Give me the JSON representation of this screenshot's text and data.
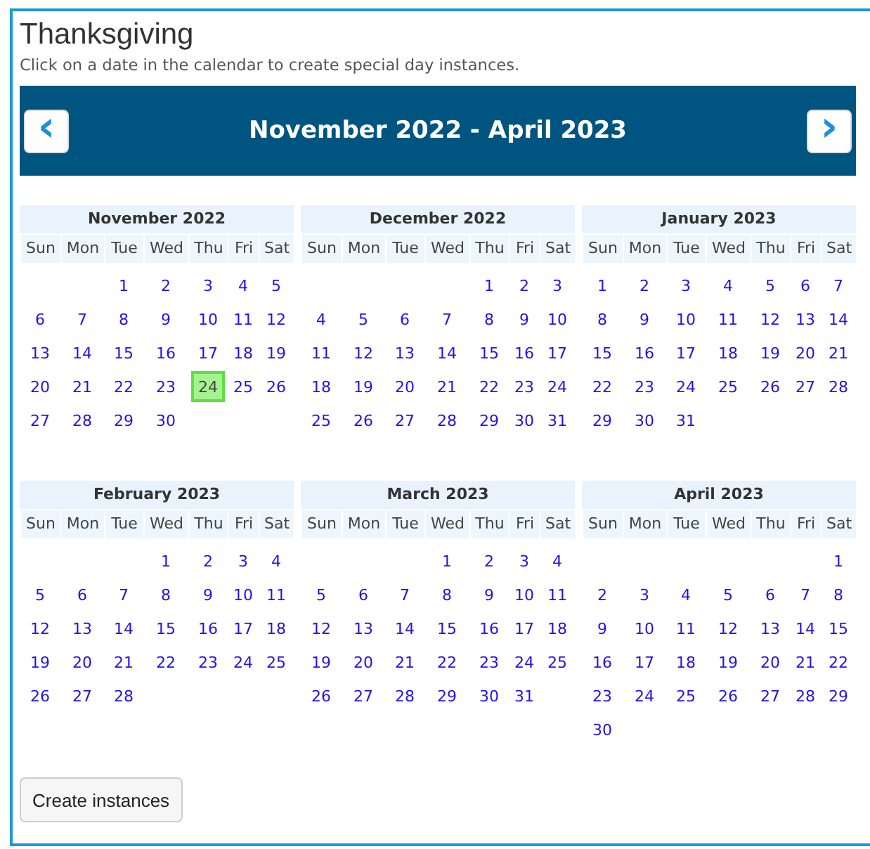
{
  "title": "Thanksgiving",
  "instructions": "Click on a date in the calendar to create special day instances.",
  "navigator": {
    "prev_button": "‹",
    "range": "November 2022 - April 2023",
    "next_button": "›"
  },
  "months": [
    {
      "name": "November 2022",
      "weekdays": [
        "Sun",
        "Mon",
        "Tue",
        "Wed",
        "Thu",
        "Fri",
        "Sat"
      ],
      "weeks": [
        [
          {
            "day": "1",
            "selected": false
          },
          {
            "day": "2",
            "selected": false
          },
          {
            "day": "3",
            "selected": false
          },
          {
            "day": "4",
            "selected": false
          },
          {
            "day": "5",
            "selected": false
          }
        ],
        [
          {
            "day": "6",
            "selected": false
          },
          {
            "day": "7",
            "selected": false
          },
          {
            "day": "8",
            "selected": false
          },
          {
            "day": "9",
            "selected": false
          },
          {
            "day": "10",
            "selected": false
          },
          {
            "day": "11",
            "selected": false
          },
          {
            "day": "12",
            "selected": false
          }
        ],
        [
          {
            "day": "13",
            "selected": false
          },
          {
            "day": "14",
            "selected": false
          },
          {
            "day": "15",
            "selected": false
          },
          {
            "day": "16",
            "selected": false
          },
          {
            "day": "17",
            "selected": false
          },
          {
            "day": "18",
            "selected": false
          },
          {
            "day": "19",
            "selected": false
          }
        ],
        [
          {
            "day": "20",
            "selected": false
          },
          {
            "day": "21",
            "selected": false
          },
          {
            "day": "22",
            "selected": false
          },
          {
            "day": "23",
            "selected": false
          },
          {
            "day": "24",
            "selected": true
          },
          {
            "day": "25",
            "selected": false
          },
          {
            "day": "26",
            "selected": false
          }
        ],
        [
          {
            "day": "27",
            "selected": false
          },
          {
            "day": "28",
            "selected": false
          },
          {
            "day": "29",
            "selected": false
          },
          {
            "day": "30",
            "selected": false
          }
        ]
      ]
    },
    {
      "name": "December 2022",
      "weekdays": [
        "Sun",
        "Mon",
        "Tue",
        "Wed",
        "Thu",
        "Fri",
        "Sat"
      ],
      "weeks": [
        [
          {
            "day": "1",
            "selected": false
          },
          {
            "day": "2",
            "selected": false
          },
          {
            "day": "3",
            "selected": false
          }
        ],
        [
          {
            "day": "4",
            "selected": false
          },
          {
            "day": "5",
            "selected": false
          },
          {
            "day": "6",
            "selected": false
          },
          {
            "day": "7",
            "selected": false
          },
          {
            "day": "8",
            "selected": false
          },
          {
            "day": "9",
            "selected": false
          },
          {
            "day": "10",
            "selected": false
          }
        ],
        [
          {
            "day": "11",
            "selected": false
          },
          {
            "day": "12",
            "selected": false
          },
          {
            "day": "13",
            "selected": false
          },
          {
            "day": "14",
            "selected": false
          },
          {
            "day": "15",
            "selected": false
          },
          {
            "day": "16",
            "selected": false
          },
          {
            "day": "17",
            "selected": false
          }
        ],
        [
          {
            "day": "18",
            "selected": false
          },
          {
            "day": "19",
            "selected": false
          },
          {
            "day": "20",
            "selected": false
          },
          {
            "day": "21",
            "selected": false
          },
          {
            "day": "22",
            "selected": false
          },
          {
            "day": "23",
            "selected": false
          },
          {
            "day": "24",
            "selected": false
          }
        ],
        [
          {
            "day": "25",
            "selected": false
          },
          {
            "day": "26",
            "selected": false
          },
          {
            "day": "27",
            "selected": false
          },
          {
            "day": "28",
            "selected": false
          },
          {
            "day": "29",
            "selected": false
          },
          {
            "day": "30",
            "selected": false
          },
          {
            "day": "31",
            "selected": false
          }
        ]
      ]
    },
    {
      "name": "January 2023",
      "weekdays": [
        "Sun",
        "Mon",
        "Tue",
        "Wed",
        "Thu",
        "Fri",
        "Sat"
      ],
      "weeks": [
        [
          {
            "day": "1",
            "selected": false
          },
          {
            "day": "2",
            "selected": false
          },
          {
            "day": "3",
            "selected": false
          },
          {
            "day": "4",
            "selected": false
          },
          {
            "day": "5",
            "selected": false
          },
          {
            "day": "6",
            "selected": false
          },
          {
            "day": "7",
            "selected": false
          }
        ],
        [
          {
            "day": "8",
            "selected": false
          },
          {
            "day": "9",
            "selected": false
          },
          {
            "day": "10",
            "selected": false
          },
          {
            "day": "11",
            "selected": false
          },
          {
            "day": "12",
            "selected": false
          },
          {
            "day": "13",
            "selected": false
          },
          {
            "day": "14",
            "selected": false
          }
        ],
        [
          {
            "day": "15",
            "selected": false
          },
          {
            "day": "16",
            "selected": false
          },
          {
            "day": "17",
            "selected": false
          },
          {
            "day": "18",
            "selected": false
          },
          {
            "day": "19",
            "selected": false
          },
          {
            "day": "20",
            "selected": false
          },
          {
            "day": "21",
            "selected": false
          }
        ],
        [
          {
            "day": "22",
            "selected": false
          },
          {
            "day": "23",
            "selected": false
          },
          {
            "day": "24",
            "selected": false
          },
          {
            "day": "25",
            "selected": false
          },
          {
            "day": "26",
            "selected": false
          },
          {
            "day": "27",
            "selected": false
          },
          {
            "day": "28",
            "selected": false
          }
        ],
        [
          {
            "day": "29",
            "selected": false
          },
          {
            "day": "30",
            "selected": false
          },
          {
            "day": "31",
            "selected": false
          }
        ]
      ]
    },
    {
      "name": "February 2023",
      "weekdays": [
        "Sun",
        "Mon",
        "Tue",
        "Wed",
        "Thu",
        "Fri",
        "Sat"
      ],
      "weeks": [
        [
          {
            "day": "1",
            "selected": false
          },
          {
            "day": "2",
            "selected": false
          },
          {
            "day": "3",
            "selected": false
          },
          {
            "day": "4",
            "selected": false
          }
        ],
        [
          {
            "day": "5",
            "selected": false
          },
          {
            "day": "6",
            "selected": false
          },
          {
            "day": "7",
            "selected": false
          },
          {
            "day": "8",
            "selected": false
          },
          {
            "day": "9",
            "selected": false
          },
          {
            "day": "10",
            "selected": false
          },
          {
            "day": "11",
            "selected": false
          }
        ],
        [
          {
            "day": "12",
            "selected": false
          },
          {
            "day": "13",
            "selected": false
          },
          {
            "day": "14",
            "selected": false
          },
          {
            "day": "15",
            "selected": false
          },
          {
            "day": "16",
            "selected": false
          },
          {
            "day": "17",
            "selected": false
          },
          {
            "day": "18",
            "selected": false
          }
        ],
        [
          {
            "day": "19",
            "selected": false
          },
          {
            "day": "20",
            "selected": false
          },
          {
            "day": "21",
            "selected": false
          },
          {
            "day": "22",
            "selected": false
          },
          {
            "day": "23",
            "selected": false
          },
          {
            "day": "24",
            "selected": false
          },
          {
            "day": "25",
            "selected": false
          }
        ],
        [
          {
            "day": "26",
            "selected": false
          },
          {
            "day": "27",
            "selected": false
          },
          {
            "day": "28",
            "selected": false
          }
        ]
      ]
    },
    {
      "name": "March 2023",
      "weekdays": [
        "Sun",
        "Mon",
        "Tue",
        "Wed",
        "Thu",
        "Fri",
        "Sat"
      ],
      "weeks": [
        [
          {
            "day": "1",
            "selected": false
          },
          {
            "day": "2",
            "selected": false
          },
          {
            "day": "3",
            "selected": false
          },
          {
            "day": "4",
            "selected": false
          }
        ],
        [
          {
            "day": "5",
            "selected": false
          },
          {
            "day": "6",
            "selected": false
          },
          {
            "day": "7",
            "selected": false
          },
          {
            "day": "8",
            "selected": false
          },
          {
            "day": "9",
            "selected": false
          },
          {
            "day": "10",
            "selected": false
          },
          {
            "day": "11",
            "selected": false
          }
        ],
        [
          {
            "day": "12",
            "selected": false
          },
          {
            "day": "13",
            "selected": false
          },
          {
            "day": "14",
            "selected": false
          },
          {
            "day": "15",
            "selected": false
          },
          {
            "day": "16",
            "selected": false
          },
          {
            "day": "17",
            "selected": false
          },
          {
            "day": "18",
            "selected": false
          }
        ],
        [
          {
            "day": "19",
            "selected": false
          },
          {
            "day": "20",
            "selected": false
          },
          {
            "day": "21",
            "selected": false
          },
          {
            "day": "22",
            "selected": false
          },
          {
            "day": "23",
            "selected": false
          },
          {
            "day": "24",
            "selected": false
          },
          {
            "day": "25",
            "selected": false
          }
        ],
        [
          {
            "day": "26",
            "selected": false
          },
          {
            "day": "27",
            "selected": false
          },
          {
            "day": "28",
            "selected": false
          },
          {
            "day": "29",
            "selected": false
          },
          {
            "day": "30",
            "selected": false
          },
          {
            "day": "31",
            "selected": false
          }
        ]
      ]
    },
    {
      "name": "April 2023",
      "weekdays": [
        "Sun",
        "Mon",
        "Tue",
        "Wed",
        "Thu",
        "Fri",
        "Sat"
      ],
      "weeks": [
        [
          {
            "day": "1",
            "selected": false
          }
        ],
        [
          {
            "day": "2",
            "selected": false
          },
          {
            "day": "3",
            "selected": false
          },
          {
            "day": "4",
            "selected": false
          },
          {
            "day": "5",
            "selected": false
          },
          {
            "day": "6",
            "selected": false
          },
          {
            "day": "7",
            "selected": false
          },
          {
            "day": "8",
            "selected": false
          }
        ],
        [
          {
            "day": "9",
            "selected": false
          },
          {
            "day": "10",
            "selected": false
          },
          {
            "day": "11",
            "selected": false
          },
          {
            "day": "12",
            "selected": false
          },
          {
            "day": "13",
            "selected": false
          },
          {
            "day": "14",
            "selected": false
          },
          {
            "day": "15",
            "selected": false
          }
        ],
        [
          {
            "day": "16",
            "selected": false
          },
          {
            "day": "17",
            "selected": false
          },
          {
            "day": "18",
            "selected": false
          },
          {
            "day": "19",
            "selected": false
          },
          {
            "day": "20",
            "selected": false
          },
          {
            "day": "21",
            "selected": false
          },
          {
            "day": "22",
            "selected": false
          }
        ],
        [
          {
            "day": "23",
            "selected": false
          },
          {
            "day": "24",
            "selected": false
          },
          {
            "day": "25",
            "selected": false
          },
          {
            "day": "26",
            "selected": false
          },
          {
            "day": "27",
            "selected": false
          },
          {
            "day": "28",
            "selected": false
          },
          {
            "day": "29",
            "selected": false
          }
        ],
        [
          {
            "day": "30",
            "selected": false
          }
        ]
      ]
    }
  ],
  "create_button": "Create instances"
}
